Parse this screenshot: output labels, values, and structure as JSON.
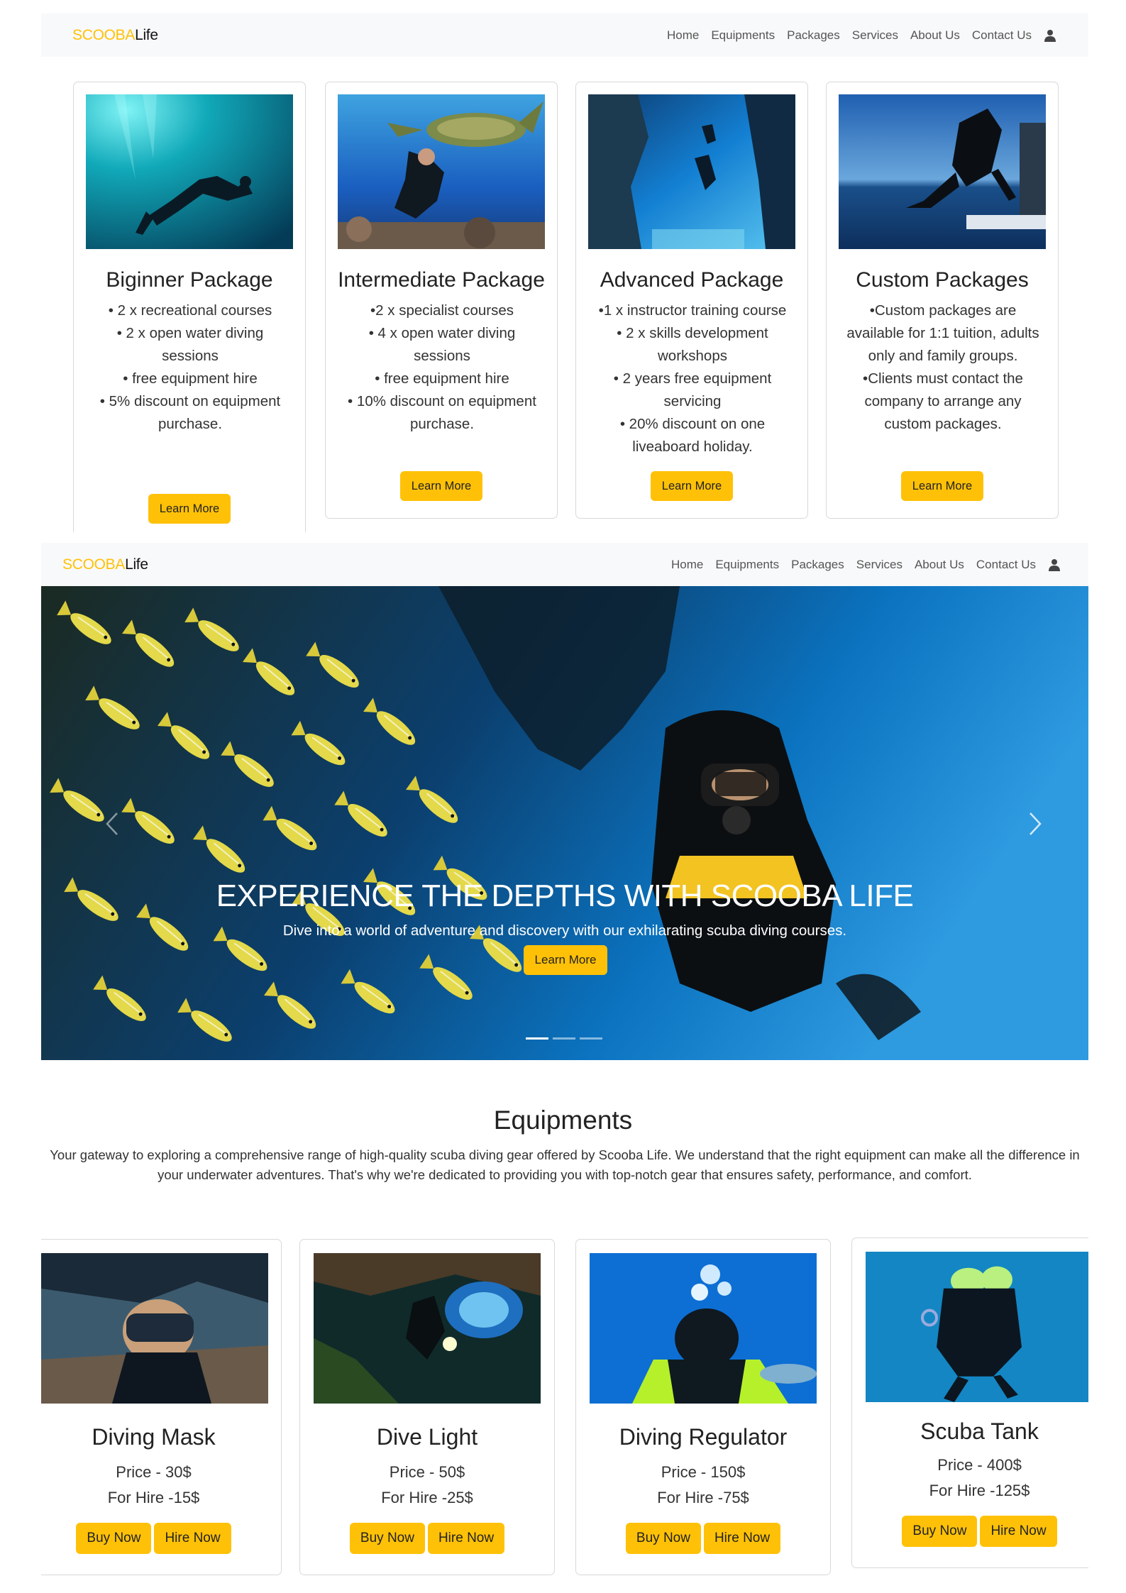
{
  "navbar": {
    "brand_part1": "SCOOBA",
    "brand_part2": "Life",
    "links": [
      "Home",
      "Equipments",
      "Packages",
      "Services",
      "About Us",
      "Contact Us"
    ],
    "user_icon": "user-icon"
  },
  "packages": [
    {
      "title": "Biginner Package",
      "lines": [
        "• 2 x recreational courses",
        "• 2 x open water diving",
        "sessions",
        "• free equipment hire",
        "• 5% discount on equipment",
        "purchase."
      ],
      "button": "Learn More"
    },
    {
      "title": "Intermediate Package",
      "lines": [
        "•2 x specialist courses",
        "• 4 x open water diving",
        "sessions",
        "• free equipment hire",
        "• 10% discount on equipment",
        "purchase."
      ],
      "button": "Learn More"
    },
    {
      "title": "Advanced Package",
      "lines": [
        "•1 x instructor training course",
        "• 2 x skills development",
        "workshops",
        "• 2 years free equipment",
        "servicing",
        "• 20% discount on one",
        "liveaboard holiday."
      ],
      "button": "Learn More"
    },
    {
      "title": "Custom Packages",
      "lines": [
        "•Custom packages are",
        "available for 1:1 tuition, adults",
        "only and family groups.",
        "•Clients must contact the",
        "company to arrange any",
        "custom packages."
      ],
      "button": "Learn More"
    }
  ],
  "hero": {
    "title": "EXPERIENCE THE DEPTHS WITH SCOOBA LIFE",
    "subtitle": "Dive into a world of adventure and discovery with our exhilarating scuba diving courses.",
    "button": "Learn More",
    "slides": 3,
    "active_slide": 1
  },
  "equipments": {
    "title": "Equipments",
    "desc_line1": "Your gateway to exploring a comprehensive range of high-quality scuba diving gear offered by Scooba Life. We understand that the right equipment can make all the difference in",
    "desc_line2": "your underwater adventures. That's why we're dedicated to providing you with top-notch gear that ensures safety, performance, and comfort.",
    "items": [
      {
        "name": "Diving Mask",
        "price": "Price - 30$",
        "hire": "For Hire -15$",
        "buy": "Buy Now",
        "hire_btn": "Hire Now"
      },
      {
        "name": "Dive Light",
        "price": "Price - 50$",
        "hire": "For Hire -25$",
        "buy": "Buy Now",
        "hire_btn": "Hire Now"
      },
      {
        "name": "Diving Regulator",
        "price": "Price - 150$",
        "hire": "For Hire -75$",
        "buy": "Buy Now",
        "hire_btn": "Hire Now"
      },
      {
        "name": "Scuba Tank",
        "price": "Price - 400$",
        "hire": "For Hire -125$",
        "buy": "Buy Now",
        "hire_btn": "Hire Now"
      }
    ]
  },
  "colors": {
    "accent": "#ffc107",
    "navbar_bg": "#f8f9fa",
    "ocean": "#0b6fb8"
  }
}
